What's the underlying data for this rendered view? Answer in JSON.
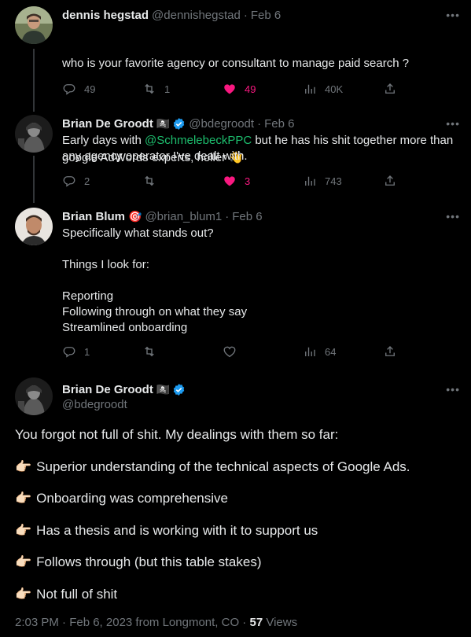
{
  "colors": {
    "background": "#000000",
    "text": "#e7e9ea",
    "muted": "#71767b",
    "like": "#f91880",
    "verified": "#1d9bf0",
    "mention": "#1dbf6e"
  },
  "tweets": [
    {
      "name": "dennis hegstad",
      "handle": "@dennishegstad",
      "date": "Feb 6",
      "text_line1": "who is your favorite agency or consultant to manage paid search ?",
      "text_line2": "google AdWords experts, holler",
      "emoji": "👋",
      "replies": "49",
      "retweets": "1",
      "likes": "49",
      "views": "40K"
    },
    {
      "name": "Brian De Groodt",
      "badge": "🏴‍☠️",
      "handle": "@bdegroodt",
      "date": "Feb 6",
      "text_pre": "Early days with ",
      "mention": "@SchmelebeckPPC",
      "text_post": " but he has his shit together more than any agency operator I've dealt with.",
      "replies": "2",
      "retweets": "",
      "likes": "3",
      "views": "743"
    },
    {
      "name": "Brian Blum",
      "badge": "🎯",
      "handle": "@brian_blum1",
      "date": "Feb 6",
      "text": "Specifically what stands out?\n\nThings I look for:\n\nReporting\nFollowing through on what they say\nStreamlined onboarding",
      "replies": "1",
      "retweets": "",
      "likes": "",
      "views": "64"
    }
  ],
  "main_tweet": {
    "name": "Brian De Groodt",
    "badge": "🏴‍☠️",
    "handle": "@bdegroodt",
    "intro": "You forgot not full of shit. My dealings with them so far:",
    "point_emoji": "👉🏻",
    "points": [
      "Superior understanding of the technical aspects of Google Ads.",
      "Onboarding was comprehensive",
      "Has a thesis and is working with it to support us",
      "Follows through (but this table stakes)",
      "Not full of shit"
    ],
    "meta_time": "2:03 PM · Feb 6, 2023 from Longmont, CO · ",
    "meta_views_count": "57",
    "meta_views_label": " Views"
  },
  "icons": {
    "reply": "reply-icon",
    "retweet": "retweet-icon",
    "like": "heart-icon",
    "views": "views-icon",
    "share": "share-icon",
    "more": "more-icon",
    "verified": "verified-icon"
  }
}
